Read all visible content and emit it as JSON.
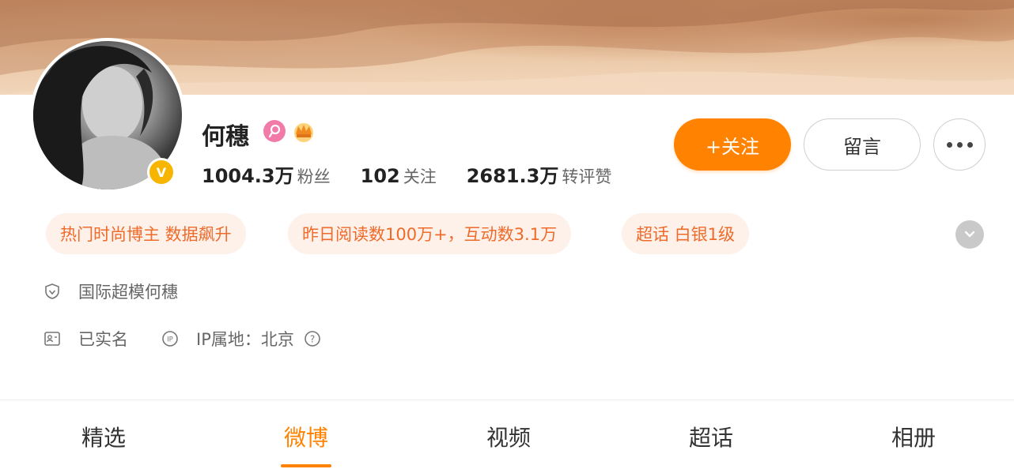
{
  "profile": {
    "name": "何穗",
    "stats": [
      {
        "value": "1004.3万",
        "label": "粉丝"
      },
      {
        "value": "102",
        "label": "关注"
      },
      {
        "value": "2681.3万",
        "label": "转评赞"
      }
    ],
    "verified_badge": "V"
  },
  "actions": {
    "follow_label": "+关注",
    "message_label": "留言",
    "more_icon": "more-dots-icon"
  },
  "tags": [
    {
      "label": "热门时尚博主 数据飙升"
    },
    {
      "label": "昨日阅读数100万+，互动数3.1万"
    },
    {
      "label": "超话 白银1级"
    }
  ],
  "info": {
    "bio": "国际超模何穗",
    "realname": "已实名",
    "ip_location": "IP属地：北京"
  },
  "tabs": [
    {
      "label": "精选"
    },
    {
      "label": "微博"
    },
    {
      "label": "视频"
    },
    {
      "label": "超话"
    },
    {
      "label": "相册"
    }
  ],
  "active_tab": "微博",
  "colors": {
    "accent": "#ff8200",
    "tag_bg": "#fdf1ea",
    "tag_text": "#f06a2a",
    "vip_pink": "#f27aa8",
    "verified_gold": "#f7b500"
  }
}
